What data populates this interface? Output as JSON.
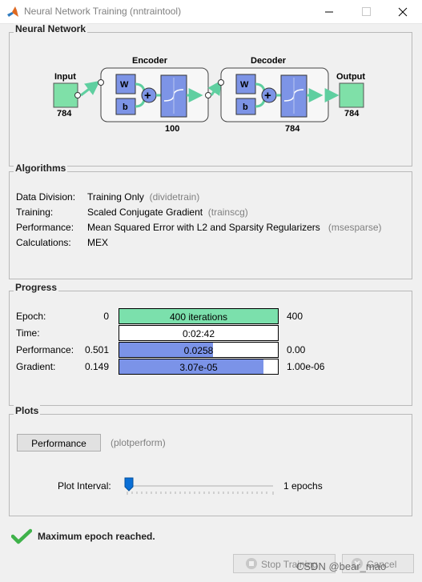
{
  "window": {
    "title": "Neural Network Training (nntraintool)",
    "controls": [
      "minimize-icon",
      "maximize-icon",
      "close-icon"
    ]
  },
  "network": {
    "heading": "Neural Network",
    "input_label": "Input",
    "input_size": "784",
    "encoder_label": "Encoder",
    "encoder_size": "100",
    "decoder_label": "Decoder",
    "decoder_size": "784",
    "output_label": "Output",
    "output_size": "784",
    "weight_label": "W",
    "bias_label": "b",
    "colors": {
      "io_box": "#7fe0a8",
      "layer_block": "#7d94e6",
      "connector": "#5fcfa0"
    }
  },
  "algorithms": {
    "heading": "Algorithms",
    "rows": [
      {
        "label": "Data Division:",
        "value": "Training Only",
        "fn": "(dividetrain)"
      },
      {
        "label": "Training:",
        "value": "Scaled Conjugate Gradient",
        "fn": "(trainscg)"
      },
      {
        "label": "Performance:",
        "value": "Mean Squared Error with L2 and Sparsity Regularizers",
        "fn": "(msesparse)"
      },
      {
        "label": "Calculations:",
        "value": "MEX",
        "fn": ""
      }
    ]
  },
  "progress": {
    "heading": "Progress",
    "rows": [
      {
        "label": "Epoch:",
        "start": "0",
        "bar_text": "400 iterations",
        "end": "400",
        "fill": 1.0,
        "color": "#7be0ac"
      },
      {
        "label": "Time:",
        "start": "",
        "bar_text": "0:02:42",
        "end": "",
        "fill": 0.0,
        "color": "#ffffff"
      },
      {
        "label": "Performance:",
        "start": "0.501",
        "bar_text": "0.0258",
        "end": "0.00",
        "fill": 0.59,
        "color": "#7b93e8"
      },
      {
        "label": "Gradient:",
        "start": "0.149",
        "bar_text": "3.07e-05",
        "end": "1.00e-06",
        "fill": 0.91,
        "color": "#7b93e8"
      }
    ]
  },
  "plots": {
    "heading": "Plots",
    "button_label": "Performance",
    "button_fn": "(plotperform)",
    "interval_label": "Plot Interval:",
    "interval_value": "1 epochs"
  },
  "status": {
    "text": "Maximum epoch reached.",
    "color": "#3fb24a"
  },
  "buttons": {
    "stop": "Stop Training",
    "cancel": "Cancel"
  },
  "watermark": "CSDN @bear_mao"
}
